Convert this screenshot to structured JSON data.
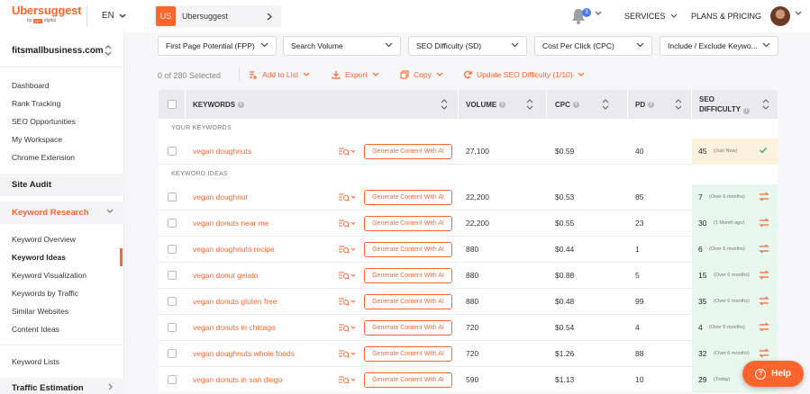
{
  "brand": {
    "name": "Ubersuggest",
    "by": "by",
    "badge": "NP",
    "sub": "digital",
    "accent": "#ff642d"
  },
  "header": {
    "language": "EN",
    "project_initials": "US",
    "project_name": "Ubersuggest",
    "notifications_count": "3",
    "services_label": "SERVICES",
    "plans_label": "PLANS & PRICING"
  },
  "sidebar": {
    "site": "fitsmallbusiness.com",
    "top_links": [
      "Dashboard",
      "Rank Tracking",
      "SEO Opportunities",
      "My Workspace",
      "Chrome Extension"
    ],
    "site_audit": "Site Audit",
    "keyword_research": "Keyword Research",
    "kr_links": [
      "Keyword Overview",
      "Keyword Ideas",
      "Keyword Visualization",
      "Keywords by Traffic",
      "Similar Websites",
      "Content Ideas"
    ],
    "keyword_lists": "Keyword Lists",
    "traffic_estimation": "Traffic Estimation",
    "active_item": "Keyword Ideas"
  },
  "filters": [
    "First Page Potential (FPP)",
    "Search Volume",
    "SEO Difficulty (SD)",
    "Cost Per Click (CPC)",
    "Include / Exclude Keywo..."
  ],
  "actions": {
    "selected": "0 of 280 Selected",
    "add_to_list": "Add to List",
    "export": "Export",
    "copy": "Copy",
    "update_sd": "Update SEO Difficulty (1/10)"
  },
  "table": {
    "headers": {
      "keywords": "KEYWORDS",
      "volume": "VOLUME",
      "cpc": "CPC",
      "pd": "PD",
      "sd_line1": "SEO",
      "sd_line2": "DIFFICULTY"
    },
    "group_your": "YOUR KEYWORDS",
    "group_ideas": "KEYWORD IDEAS",
    "generate_label": "Generate Content With AI",
    "your_keywords": [
      {
        "keyword": "vegan doughnuts",
        "volume": "27,100",
        "cpc": "$0.59",
        "pd": "40",
        "sd": "45",
        "note": "(Just Now)"
      }
    ],
    "ideas": [
      {
        "keyword": "vegan doughnut",
        "volume": "22,200",
        "cpc": "$0.53",
        "pd": "85",
        "sd": "7",
        "note": "(Over 6 months)"
      },
      {
        "keyword": "vegan donuts near me",
        "volume": "22,200",
        "cpc": "$0.55",
        "pd": "23",
        "sd": "30",
        "note": "(1 Month ago)"
      },
      {
        "keyword": "vegan doughnuts recipe",
        "volume": "880",
        "cpc": "$0.44",
        "pd": "1",
        "sd": "6",
        "note": "(Over 6 months)"
      },
      {
        "keyword": "vegan donut gelato",
        "volume": "880",
        "cpc": "$0.88",
        "pd": "5",
        "sd": "15",
        "note": "(Over 6 months)"
      },
      {
        "keyword": "vegan donuts gluten free",
        "volume": "880",
        "cpc": "$0.48",
        "pd": "99",
        "sd": "35",
        "note": "(Over 6 months)"
      },
      {
        "keyword": "vegan donuts in chicago",
        "volume": "720",
        "cpc": "$0.54",
        "pd": "4",
        "sd": "4",
        "note": "(Over 6 months)"
      },
      {
        "keyword": "vegan doughnuts whole foods",
        "volume": "720",
        "cpc": "$1.26",
        "pd": "88",
        "sd": "32",
        "note": "(Over 6 months)"
      },
      {
        "keyword": "vegan donuts in san diego",
        "volume": "590",
        "cpc": "$1.13",
        "pd": "10",
        "sd": "29",
        "note": "(Today)"
      }
    ]
  },
  "help": {
    "label": "Help"
  }
}
